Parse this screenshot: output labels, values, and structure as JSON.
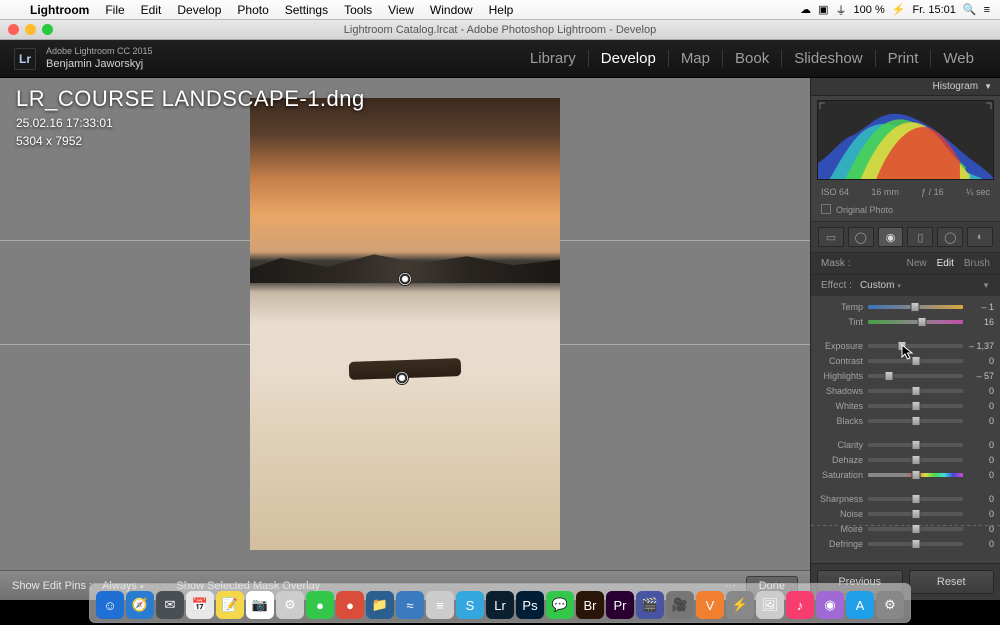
{
  "menubar": {
    "app": "Lightroom",
    "items": [
      "File",
      "Edit",
      "Develop",
      "Photo",
      "Settings",
      "Tools",
      "View",
      "Window",
      "Help"
    ],
    "right": {
      "battery": "100 %",
      "batt_icon": "⚡",
      "clock": "Fr. 15:01"
    }
  },
  "window": {
    "title": "Lightroom Catalog.lrcat - Adobe Photoshop Lightroom - Develop"
  },
  "identity": {
    "product": "Adobe Lightroom CC 2015",
    "user": "Benjamin Jaworskyj"
  },
  "modules": [
    "Library",
    "Develop",
    "Map",
    "Book",
    "Slideshow",
    "Print",
    "Web"
  ],
  "active_module": "Develop",
  "overlay": {
    "filename": "LR_COURSE LANDSCAPE-1.dng",
    "datetime": "25.02.16 17:33:01",
    "dims": "5304 x 7952"
  },
  "toolbar": {
    "pins_label": "Show Edit Pins :",
    "pins_value": "Always",
    "mask": "Show Selected Mask Overlay",
    "done": "Done"
  },
  "panel": {
    "histogram": "Histogram",
    "meta": {
      "iso": "ISO 64",
      "focal": "16 mm",
      "ap": "ƒ / 16",
      "sh": "¼ sec"
    },
    "original": "Original Photo",
    "mask": {
      "label": "Mask :",
      "new": "New",
      "edit": "Edit",
      "brush": "Brush"
    },
    "effect": {
      "label": "Effect :",
      "value": "Custom"
    },
    "sliders": [
      {
        "name": "Temp",
        "val": "– 1",
        "pos": 49,
        "cls": "temp"
      },
      {
        "name": "Tint",
        "val": "16",
        "pos": 57,
        "cls": "tint"
      }
    ],
    "sliders2": [
      {
        "name": "Exposure",
        "val": "– 1,37",
        "pos": 36
      },
      {
        "name": "Contrast",
        "val": "0",
        "pos": 50
      },
      {
        "name": "Highlights",
        "val": "– 57",
        "pos": 22
      },
      {
        "name": "Shadows",
        "val": "0",
        "pos": 50
      },
      {
        "name": "Whites",
        "val": "0",
        "pos": 50
      },
      {
        "name": "Blacks",
        "val": "0",
        "pos": 50
      }
    ],
    "sliders3": [
      {
        "name": "Clarity",
        "val": "0",
        "pos": 50
      },
      {
        "name": "Dehaze",
        "val": "0",
        "pos": 50
      },
      {
        "name": "Saturation",
        "val": "0",
        "pos": 50,
        "cls": "sat"
      }
    ],
    "sliders4": [
      {
        "name": "Sharpness",
        "val": "0",
        "pos": 50
      },
      {
        "name": "Noise",
        "val": "0",
        "pos": 50
      },
      {
        "name": "Moire",
        "val": "0",
        "pos": 50
      },
      {
        "name": "Defringe",
        "val": "0",
        "pos": 50
      }
    ],
    "buttons": {
      "prev": "Previous",
      "reset": "Reset"
    }
  },
  "dock": [
    {
      "c": "#1f6fd4",
      "t": "☺"
    },
    {
      "c": "#2a7cd0",
      "t": "🧭"
    },
    {
      "c": "#4a4f56",
      "t": "✉"
    },
    {
      "c": "#e8e8e8",
      "t": "📅"
    },
    {
      "c": "#f5d74a",
      "t": "📝"
    },
    {
      "c": "#fff",
      "t": "📷"
    },
    {
      "c": "#ccc",
      "t": "⚙"
    },
    {
      "c": "#34c84a",
      "t": "●"
    },
    {
      "c": "#d94d3a",
      "t": "●"
    },
    {
      "c": "#2a5f8f",
      "t": "📁"
    },
    {
      "c": "#3a7bbf",
      "t": "≈"
    },
    {
      "c": "#ccc",
      "t": "≡"
    },
    {
      "c": "#34a7de",
      "t": "S"
    },
    {
      "c": "#0a2030",
      "t": "Lr"
    },
    {
      "c": "#001e36",
      "t": "Ps"
    },
    {
      "c": "#34c84a",
      "t": "💬"
    },
    {
      "c": "#2a1506",
      "t": "Br"
    },
    {
      "c": "#2a0033",
      "t": "Pr"
    },
    {
      "c": "#4855a3",
      "t": "🎬"
    },
    {
      "c": "#777",
      "t": "🎥"
    },
    {
      "c": "#f08030",
      "t": "V"
    },
    {
      "c": "#888",
      "t": "⚡"
    },
    {
      "c": "#ccc",
      "t": "🖼"
    },
    {
      "c": "#f73c6e",
      "t": "♪"
    },
    {
      "c": "#a069d6",
      "t": "◉"
    },
    {
      "c": "#1f9fe8",
      "t": "A"
    },
    {
      "c": "#888",
      "t": "⚙"
    }
  ]
}
